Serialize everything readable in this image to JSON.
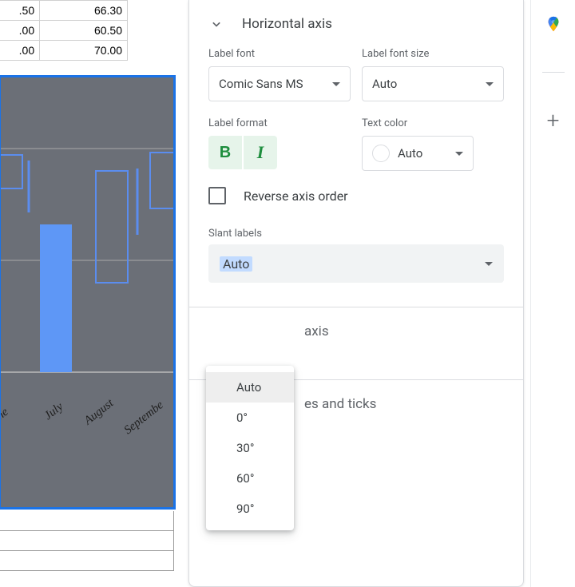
{
  "sheet": {
    "rows": [
      [
        ".50",
        "66.30"
      ],
      [
        ".00",
        "60.50"
      ],
      [
        ".00",
        "70.00"
      ]
    ]
  },
  "chart": {
    "x_labels": [
      "ne",
      "July",
      "August",
      "Septembe"
    ]
  },
  "panel": {
    "section_title": "Horizontal axis",
    "label_font": {
      "label": "Label font",
      "value": "Comic Sans MS"
    },
    "label_font_size": {
      "label": "Label font size",
      "value": "Auto"
    },
    "label_format": {
      "label": "Label format",
      "bold": "B",
      "italic": "I"
    },
    "text_color": {
      "label": "Text color",
      "value": "Auto"
    },
    "reverse_axis": "Reverse axis order",
    "slant": {
      "label": "Slant labels",
      "value": "Auto",
      "options": [
        "Auto",
        "0°",
        "30°",
        "60°",
        "90°"
      ]
    }
  },
  "collapsed_sections": {
    "s1_suffix": "axis",
    "s2_suffix": "es and ticks"
  }
}
